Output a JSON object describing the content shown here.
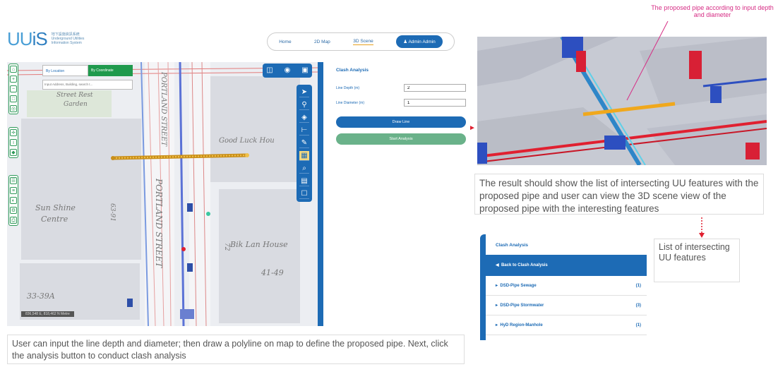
{
  "logo": {
    "mark": "UU",
    "mark_i": "iS",
    "subtitle": "地下設施資訊系統 Underground Utilities Information System"
  },
  "nav": {
    "home": "Home",
    "map2d": "2D Map",
    "scene3d": "3D Scene",
    "admin": "Admin Admin"
  },
  "search": {
    "tab_location": "By Location",
    "tab_coordinate": "By Coordinate",
    "placeholder": "Input Address, Building, search t..."
  },
  "map": {
    "labels": {
      "portland1": "PORTLAND STREET",
      "portland2": "PORTLAND STREET",
      "street_rest": "Street Rest",
      "garden": "Garden",
      "good_luck": "Good Luck Hou",
      "sun_shine": "Sun Shine",
      "centre": "Centre",
      "bik_lan": "Bik Lan House",
      "n4149": "41-49",
      "n3339": "33-39A",
      "n6391": "63-91",
      "n72": "72"
    },
    "coords": "836,548 E, 818,462 N Metre"
  },
  "panel": {
    "title": "Clash Analysis",
    "depth_label": "Line Depth (m)",
    "depth_value": "2",
    "diameter_label": "Line Diameter (m)",
    "diameter_value": "1",
    "draw_button": "Draw Line",
    "start_button": "Start Analysis"
  },
  "annotation": "The proposed pipe according to input depth and diameter",
  "captions": {
    "result_note": "The result should show the list of intersecting UU features with the proposed pipe and user can view the 3D scene view of the proposed pipe with the interesting features",
    "input_note": "User can input the line depth and diameter; then draw a polyline on map to define the proposed pipe. Next, click the analysis button to conduct clash analysis",
    "list_note": "List of intersecting UU features"
  },
  "results": {
    "title": "Clash Analysis",
    "back": "Back to Clash Analysis",
    "items": [
      {
        "name": "DSD-Pipe Sewage",
        "count": "(1)"
      },
      {
        "name": "DSD-Pipe Stormwater",
        "count": "(3)"
      },
      {
        "name": "HyD Region-Manhole",
        "count": "(1)"
      }
    ]
  },
  "colors": {
    "primary": "#1d6bb5",
    "green": "#1f9a4d",
    "pipe": "#e6a11f",
    "annotation": "#d62c84"
  }
}
